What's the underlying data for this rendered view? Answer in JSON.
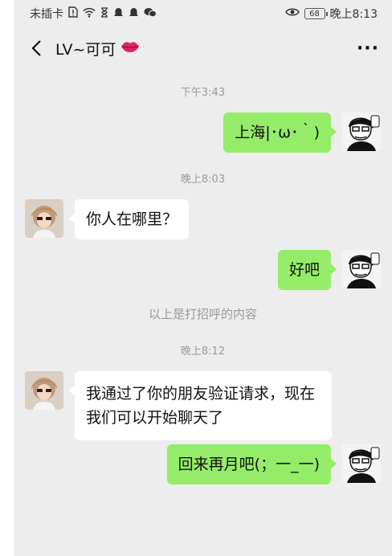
{
  "status": {
    "carrier": "未插卡",
    "time": "晚上8:13",
    "battery": "68",
    "left_icons": [
      "sim-alert-icon",
      "wifi-icon",
      "hourglass-icon",
      "notification-icon",
      "notification-icon",
      "wechat-icon"
    ],
    "right_icons": [
      "eye-icon"
    ]
  },
  "header": {
    "title": "LV~可可",
    "title_emoji": "lips-icon",
    "more": "···"
  },
  "conversation": {
    "stamp1": "下午3:43",
    "msg1": "上海|･ω･｀)",
    "stamp2": "晚上8:03",
    "msg2": "你人在哪里？",
    "msg3": "好吧",
    "notice": "以上是打招呼的内容",
    "stamp3": "晚上8:12",
    "msg4": "我通过了你的朋友验证请求，现在我们可以开始聊天了",
    "msg5": "回来再月吧(；一_一)"
  },
  "colors": {
    "background": "#ededed",
    "sent_bubble": "#95ec69",
    "received_bubble": "#ffffff",
    "timestamp": "#9a9a9a"
  }
}
